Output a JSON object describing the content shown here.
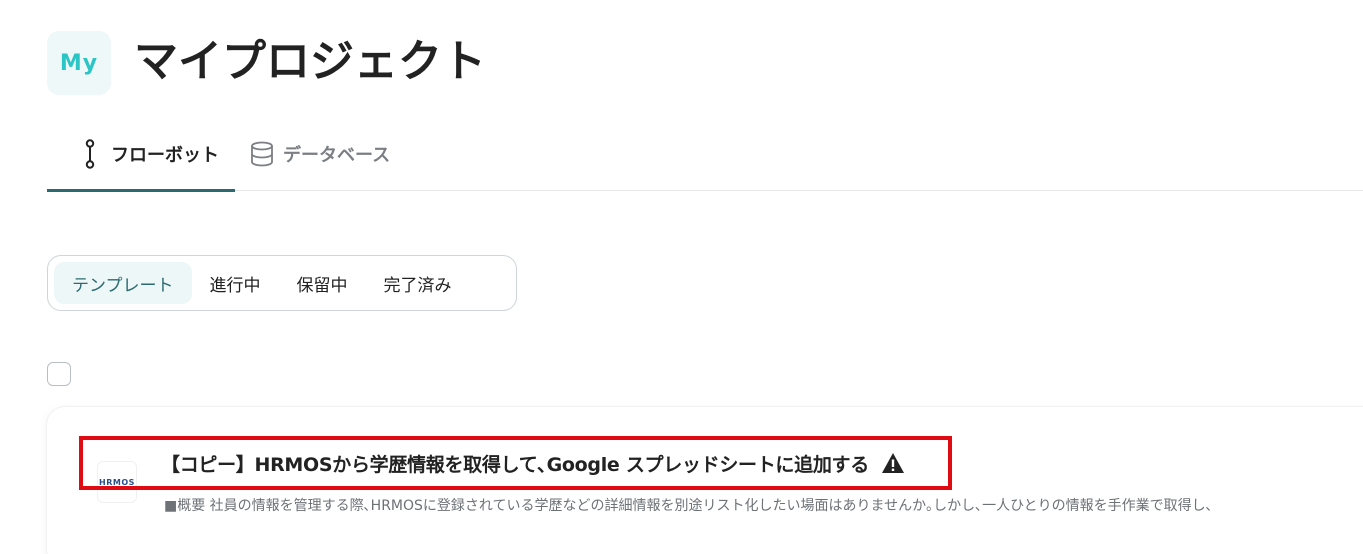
{
  "header": {
    "badge": "My",
    "title": "マイプロジェクト"
  },
  "main_tabs": [
    {
      "label": "フローボット",
      "icon": "flowbot-icon",
      "active": true
    },
    {
      "label": "データベース",
      "icon": "database-icon",
      "active": false
    }
  ],
  "status_filter": [
    {
      "label": "テンプレート",
      "active": true
    },
    {
      "label": "進行中",
      "active": false
    },
    {
      "label": "保留中",
      "active": false
    },
    {
      "label": "完了済み",
      "active": false
    }
  ],
  "flow_cards": [
    {
      "app_logo": "HRMOS",
      "title": "【コピー】HRMOSから学歴情報を取得して､Google スプレッドシートに追加する",
      "warning_icon": "warning-icon",
      "description": "■概要 社員の情報を管理する際､HRMOSに登録されている学歴などの詳細情報を別途リスト化したい場面はありませんか｡しかし､一人ひとりの情報を手作業で取得し､"
    }
  ],
  "colors": {
    "accent": "#2a6a70",
    "badge_text": "#2cc5c5",
    "highlight_border": "#e00a12"
  }
}
